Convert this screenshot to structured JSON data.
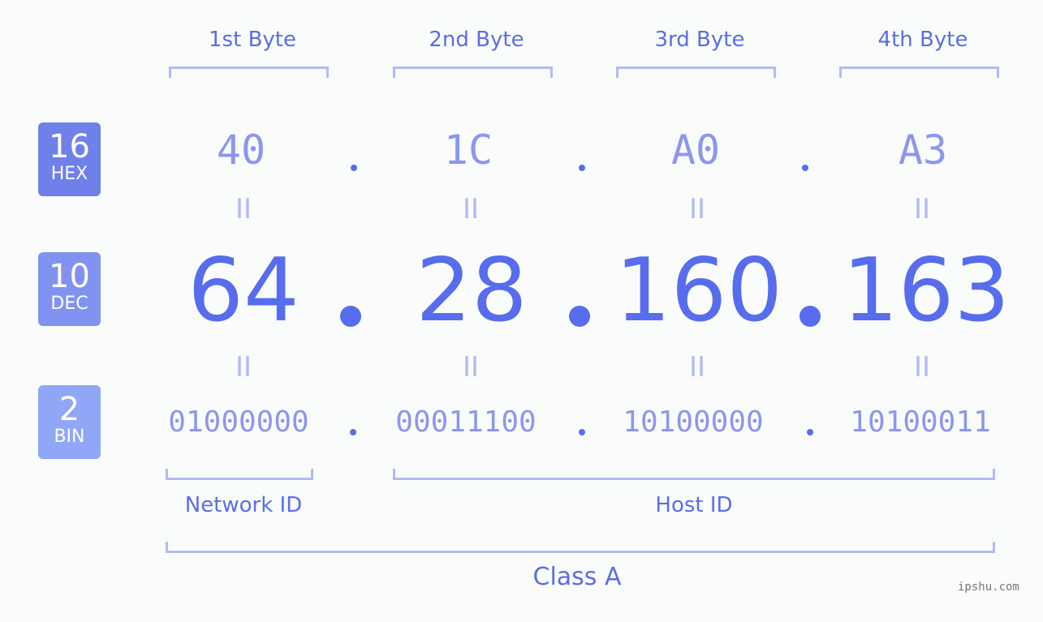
{
  "colors": {
    "accent": "#576ded",
    "hex_value": "#8d96ee",
    "bracket": "#b1baf5",
    "hex_badge": "#6f80ea",
    "dec_badge": "#8192f0",
    "bin_badge": "#90a6f6",
    "background": "#fafcfb"
  },
  "bytes": [
    {
      "label": "1st Byte",
      "hex": "40",
      "dec": "64",
      "bin": "01000000"
    },
    {
      "label": "2nd Byte",
      "hex": "1C",
      "dec": "28",
      "bin": "00011100"
    },
    {
      "label": "3rd Byte",
      "hex": "A0",
      "dec": "160",
      "bin": "10100000"
    },
    {
      "label": "4th Byte",
      "hex": "A3",
      "dec": "163",
      "bin": "10100011"
    }
  ],
  "bases": {
    "hex": {
      "num": "16",
      "name": "HEX"
    },
    "dec": {
      "num": "10",
      "name": "DEC"
    },
    "bin": {
      "num": "2",
      "name": "BIN"
    }
  },
  "equals_glyph": "II",
  "network_id_label": "Network ID",
  "host_id_label": "Host ID",
  "class_label": "Class A",
  "watermark": "ipshu.com"
}
